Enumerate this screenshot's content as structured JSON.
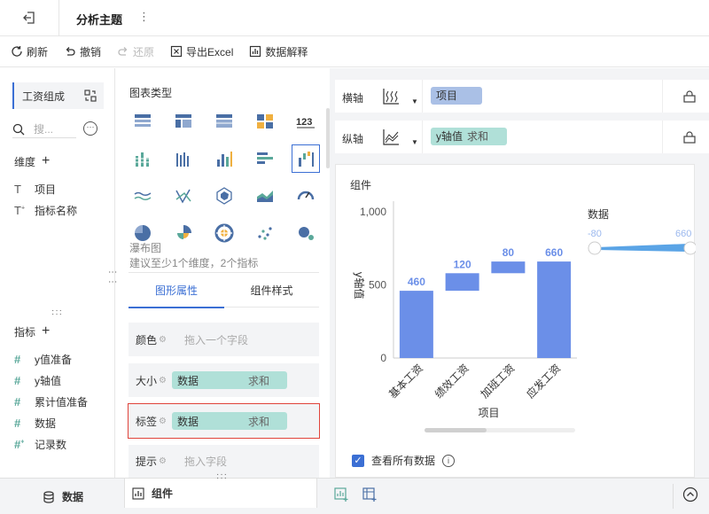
{
  "topbar": {
    "title": "分析主题",
    "more": "⋮"
  },
  "toolbar": {
    "refresh": "刷新",
    "undo": "撤销",
    "redo": "还原",
    "export": "导出Excel",
    "explain": "数据解释"
  },
  "left": {
    "dataset": "工资组成",
    "search_placeholder": "搜...",
    "dimension_title": "维度",
    "dimensions": [
      "项目",
      "指标名称"
    ],
    "metric_title": "指标",
    "metrics": [
      "y值准备",
      "y轴值",
      "累计值准备",
      "数据",
      "记录数"
    ]
  },
  "middle": {
    "chart_type_title": "图表类型",
    "selected_chart_name": "瀑布图",
    "selected_chart_hint": "建议至少1个维度，2个指标",
    "tabs": [
      "图形属性",
      "组件样式"
    ],
    "props": {
      "color": {
        "label": "颜色",
        "placeholder": "拖入一个字段"
      },
      "size": {
        "label": "大小",
        "field": "数据",
        "agg": "求和"
      },
      "label": {
        "label": "标签",
        "field": "数据",
        "agg": "求和"
      },
      "tooltip": {
        "label": "提示",
        "placeholder": "拖入字段"
      }
    }
  },
  "right": {
    "x_axis_label": "横轴",
    "x_field": "项目",
    "y_axis_label": "纵轴",
    "y_field": "y轴值",
    "y_agg": "求和",
    "component_title": "组件",
    "show_all": "查看所有数据"
  },
  "chart_data": {
    "type": "bar",
    "subtype": "waterfall",
    "categories": [
      "基本工资",
      "绩效工资",
      "加班工资",
      "应发工资"
    ],
    "values": [
      460,
      120,
      80,
      660
    ],
    "bases": [
      0,
      460,
      580,
      0
    ],
    "xlabel": "项目",
    "ylabel": "y轴值",
    "ylim": [
      0,
      1000
    ],
    "yticks": [
      "0",
      "500",
      "1,000"
    ],
    "legend_title": "数据",
    "legend_min": "-80",
    "legend_max": "660",
    "bar_color": "#6b8fe8",
    "label_color": "#6b8fe8"
  },
  "bottom": {
    "data_tab": "数据",
    "component_tab": "组件"
  }
}
